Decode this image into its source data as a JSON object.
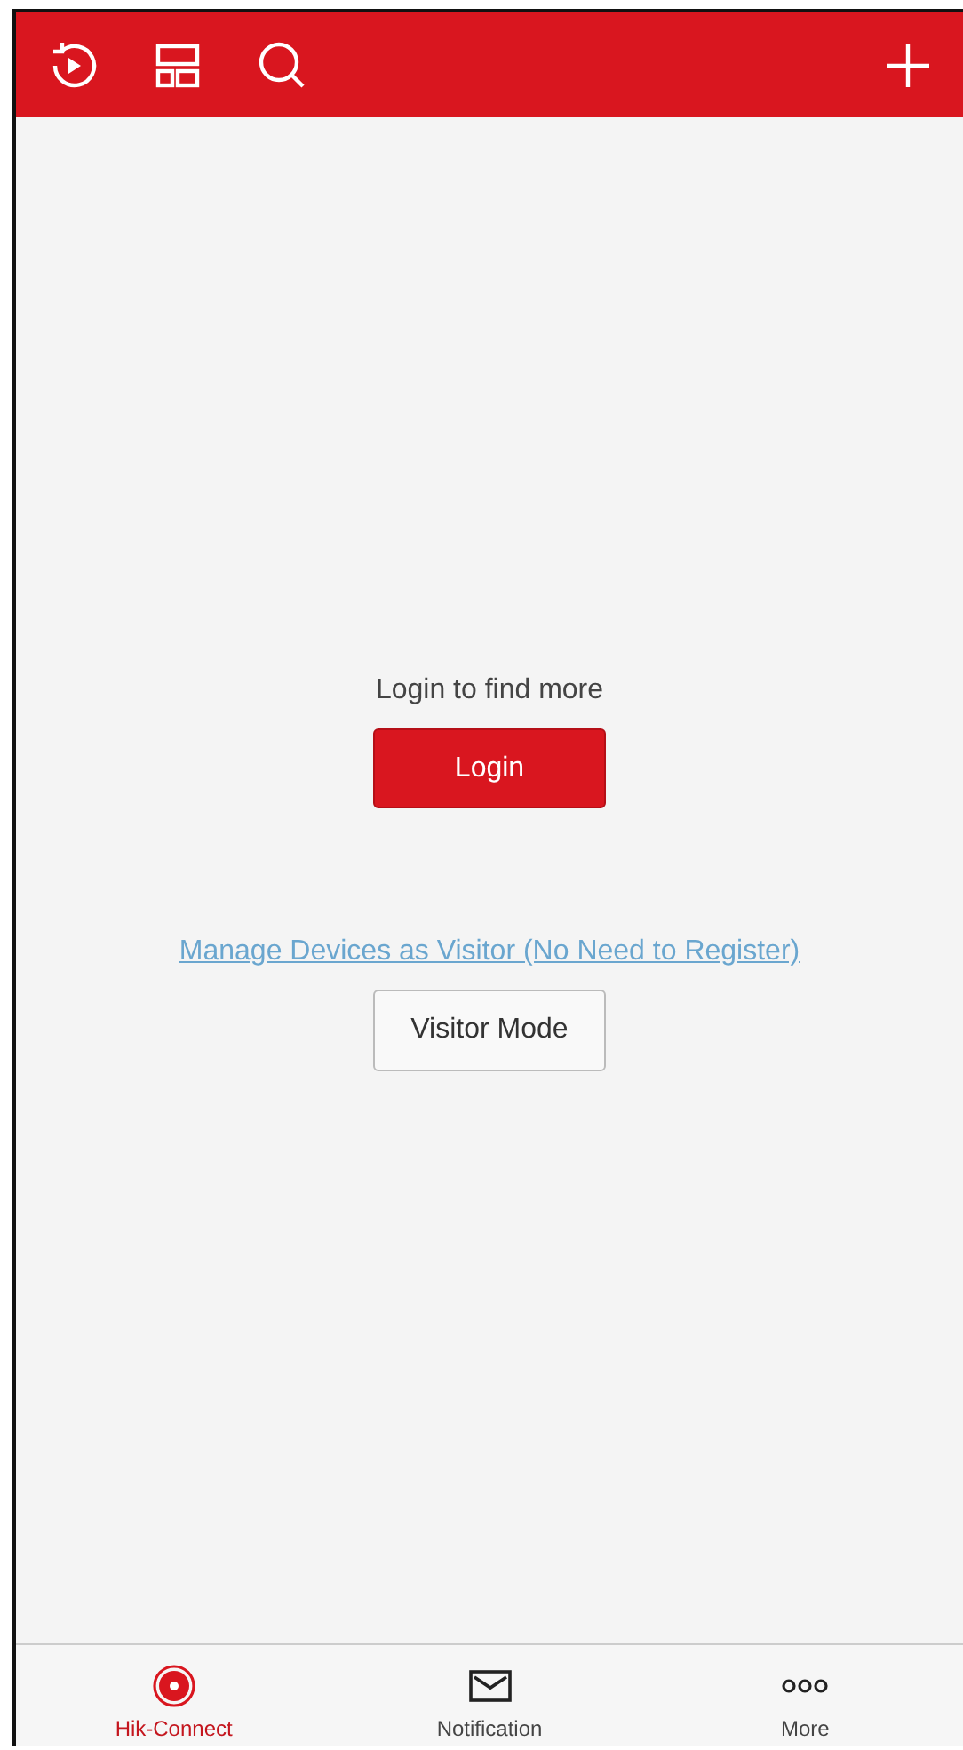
{
  "main": {
    "prompt": "Login to find more",
    "login_button": "Login",
    "visitor_link": "Manage Devices as Visitor (No Need to Register)",
    "visitor_button": "Visitor Mode"
  },
  "tabs": [
    {
      "label": "Hik-Connect",
      "selected": true
    },
    {
      "label": "Notification",
      "selected": false
    },
    {
      "label": "More",
      "selected": false
    }
  ]
}
